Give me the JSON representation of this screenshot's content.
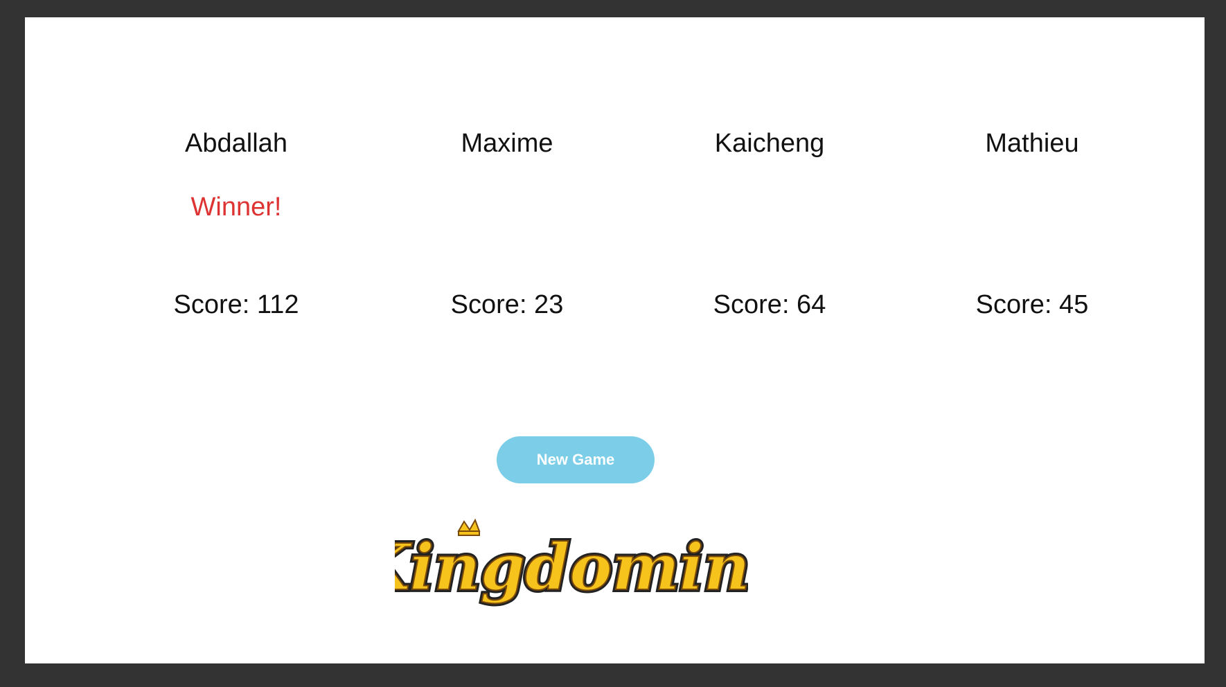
{
  "players": [
    {
      "name": "Abdallah",
      "status": "Winner!",
      "score": "Score: 112"
    },
    {
      "name": "Maxime",
      "status": "",
      "score": "Score: 23"
    },
    {
      "name": "Kaicheng",
      "status": "",
      "score": "Score: 64"
    },
    {
      "name": "Mathieu",
      "status": "",
      "score": "Score: 45"
    }
  ],
  "actions": {
    "new_game_label": "New Game"
  },
  "logo": {
    "text": "Kingdomino"
  },
  "colors": {
    "winner": "#dd3333",
    "button": "#7bcde8",
    "logo_fill": "#f6c21c",
    "logo_outline": "#7a4a0a"
  }
}
